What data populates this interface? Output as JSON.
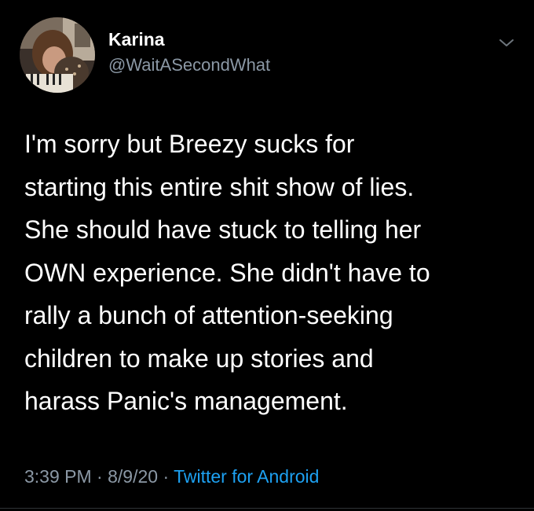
{
  "tweet": {
    "author": {
      "display_name": "Karina",
      "handle": "@WaitASecondWhat"
    },
    "text_lines": [
      "I'm sorry but Breezy sucks for",
      "starting this entire shit show of lies.",
      "She should have stuck to telling her",
      "OWN experience. She didn't have to",
      "rally a bunch of attention-seeking",
      "children to make up stories and",
      "harass Panic's management."
    ],
    "meta": {
      "time": "3:39 PM",
      "separator": " · ",
      "date": "8/9/20",
      "source": "Twitter for Android"
    },
    "icons": {
      "menu": "chevron-down-icon",
      "avatar": "avatar"
    }
  },
  "colors": {
    "background": "#000000",
    "text": "#ffffff",
    "secondary_text": "#8b98a5",
    "link": "#1da1f2"
  }
}
